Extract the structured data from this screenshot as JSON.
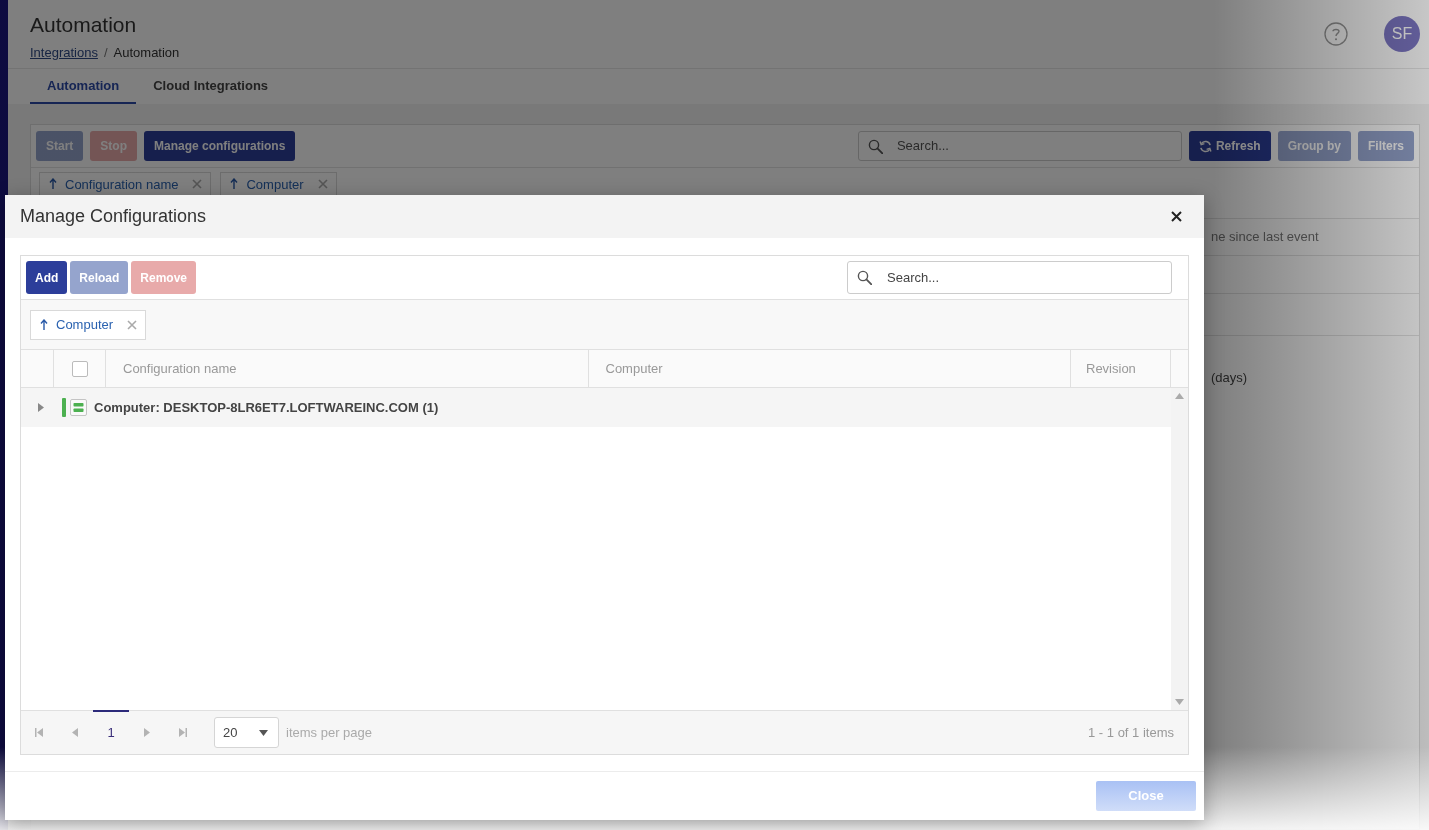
{
  "page": {
    "title": "Automation",
    "breadcrumb": [
      {
        "label": "Integrations",
        "kind": "link"
      },
      {
        "label": "/",
        "kind": "separator"
      },
      {
        "label": "Automation",
        "kind": "current"
      }
    ],
    "avatar": {
      "initials": "SF"
    }
  },
  "tabs": [
    {
      "label": "Automation",
      "selected": true
    },
    {
      "label": "Cloud Integrations",
      "selected": false
    }
  ],
  "toolbar": {
    "buttons": [
      {
        "label": "Start",
        "kind": "primary",
        "disabled": true
      },
      {
        "label": "Stop",
        "kind": "danger",
        "disabled": true
      },
      {
        "label": "Manage configurations",
        "kind": "primary",
        "disabled": false
      }
    ],
    "search": {
      "placeholder": "Search..."
    },
    "actions": [
      {
        "label": "Refresh",
        "kind": "iconic",
        "disabled": false
      },
      {
        "label": "Group by",
        "kind": "plain",
        "disabled": true
      },
      {
        "label": "Filters",
        "kind": "plain",
        "disabled": true
      }
    ]
  },
  "group_chips": [
    {
      "label": "Configuration name",
      "ascending": true
    },
    {
      "label": "Computer",
      "ascending": true
    }
  ],
  "grid": {
    "column_header": "ne since last event",
    "row_text": "(days)"
  },
  "dialog": {
    "title": "Manage Configurations",
    "toolbar": {
      "buttons": [
        {
          "label": "Add",
          "kind": "primary",
          "disabled": false
        },
        {
          "label": "Reload",
          "kind": "primary",
          "disabled": true
        },
        {
          "label": "Remove",
          "kind": "danger",
          "disabled": true
        }
      ],
      "search": {
        "placeholder": "Search..."
      }
    },
    "group_chips": [
      {
        "label": "Computer",
        "ascending": true
      }
    ],
    "table": {
      "select_all": {
        "checked": false
      },
      "columns": [
        "Configuration name",
        "Computer",
        "Revision"
      ],
      "groups": [
        {
          "label": "Computer: DESKTOP-8LR6ET7.LOFTWAREINC.COM (1)",
          "expanded": false
        }
      ]
    },
    "pager": {
      "nav": [
        {
          "kind": "first",
          "disabled": true
        },
        {
          "kind": "previous",
          "disabled": true
        },
        {
          "kind": "next",
          "disabled": true
        },
        {
          "kind": "last",
          "disabled": true
        }
      ],
      "pages": [
        {
          "label": "1",
          "selected": true
        }
      ],
      "page_size": "20",
      "page_size_label": "items per page",
      "summary": "1 - 1 of 1 items"
    },
    "footer": {
      "buttons": [
        {
          "label": "Close",
          "kind": "accent",
          "disabled": true
        }
      ]
    }
  }
}
